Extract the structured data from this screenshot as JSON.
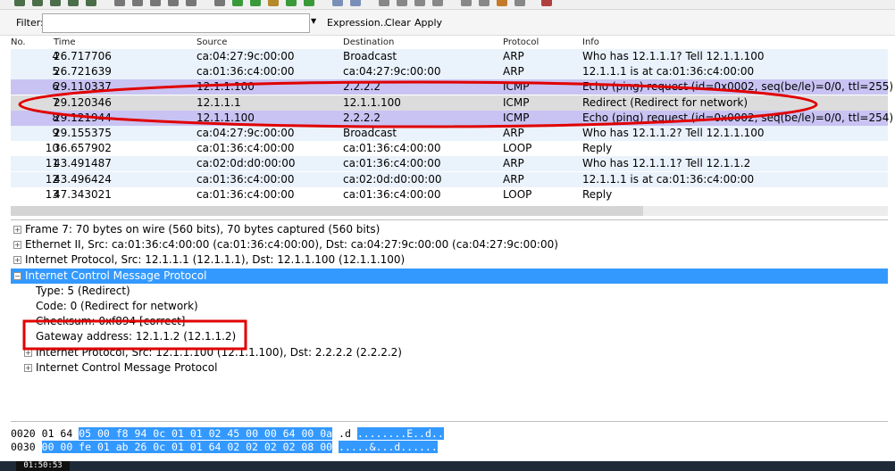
{
  "colors": {
    "arp_row": "#eaf2fb",
    "icmp_row": "#c8c3f3",
    "selected": "#dcdcdc",
    "broadcast_row": "#eaf2fb",
    "detail_selected": "#3399ff",
    "annotation": "#e00000"
  },
  "filter": {
    "label": "Filter:",
    "value": "",
    "expression_label": "Expression...",
    "clear_label": "Clear",
    "apply_label": "Apply"
  },
  "columns": [
    "No.",
    "Time",
    "Source",
    "Destination",
    "Protocol",
    "Info"
  ],
  "packets": [
    {
      "no": "4",
      "time": "26.717706",
      "src": "ca:04:27:9c:00:00",
      "dst": "Broadcast",
      "proto": "ARP",
      "info": "Who has 12.1.1.1?  Tell 12.1.1.100",
      "kind": "arp"
    },
    {
      "no": "5",
      "time": "26.721639",
      "src": "ca:01:36:c4:00:00",
      "dst": "ca:04:27:9c:00:00",
      "proto": "ARP",
      "info": "12.1.1.1 is at ca:01:36:c4:00:00",
      "kind": "arp"
    },
    {
      "no": "6",
      "time": "29.110337",
      "src": "12.1.1.100",
      "dst": "2.2.2.2",
      "proto": "ICMP",
      "info": "Echo (ping) request  (id=0x0002, seq(be/le)=0/0, ttl=255)",
      "kind": "icmp"
    },
    {
      "no": "7",
      "time": "29.120346",
      "src": "12.1.1.1",
      "dst": "12.1.1.100",
      "proto": "ICMP",
      "info": "Redirect             (Redirect for network)",
      "kind": "selected"
    },
    {
      "no": "8",
      "time": "29.121944",
      "src": "12.1.1.100",
      "dst": "2.2.2.2",
      "proto": "ICMP",
      "info": "Echo (ping) request  (id=0x0002, seq(be/le)=0/0, ttl=254)",
      "kind": "icmp"
    },
    {
      "no": "9",
      "time": "29.155375",
      "src": "ca:04:27:9c:00:00",
      "dst": "Broadcast",
      "proto": "ARP",
      "info": "Who has 12.1.1.2?  Tell 12.1.1.100",
      "kind": "arp"
    },
    {
      "no": "10",
      "time": "36.657902",
      "src": "ca:01:36:c4:00:00",
      "dst": "ca:01:36:c4:00:00",
      "proto": "LOOP",
      "info": "Reply",
      "kind": "plain"
    },
    {
      "no": "11",
      "time": "43.491487",
      "src": "ca:02:0d:d0:00:00",
      "dst": "ca:01:36:c4:00:00",
      "proto": "ARP",
      "info": "Who has 12.1.1.1?  Tell 12.1.1.2",
      "kind": "arp"
    },
    {
      "no": "12",
      "time": "43.496424",
      "src": "ca:01:36:c4:00:00",
      "dst": "ca:02:0d:d0:00:00",
      "proto": "ARP",
      "info": "12.1.1.1 is at ca:01:36:c4:00:00",
      "kind": "arp"
    },
    {
      "no": "13",
      "time": "47.343021",
      "src": "ca:01:36:c4:00:00",
      "dst": "ca:01:36:c4:00:00",
      "proto": "LOOP",
      "info": "Reply",
      "kind": "plain"
    }
  ],
  "details": [
    {
      "text": "Frame 7: 70 bytes on wire (560 bits), 70 bytes captured (560 bits)",
      "expander": "⊞",
      "level": 0,
      "selected": false
    },
    {
      "text": "Ethernet II, Src: ca:01:36:c4:00:00 (ca:01:36:c4:00:00), Dst: ca:04:27:9c:00:00 (ca:04:27:9c:00:00)",
      "expander": "⊞",
      "level": 0,
      "selected": false
    },
    {
      "text": "Internet Protocol, Src: 12.1.1.1 (12.1.1.1), Dst: 12.1.1.100 (12.1.1.100)",
      "expander": "⊞",
      "level": 0,
      "selected": false
    },
    {
      "text": "Internet Control Message Protocol",
      "expander": "⊟",
      "level": 0,
      "selected": true
    },
    {
      "text": "Type: 5 (Redirect)",
      "expander": "",
      "level": 1,
      "selected": false
    },
    {
      "text": "Code: 0 (Redirect for network)",
      "expander": "",
      "level": 1,
      "selected": false
    },
    {
      "text": "Checksum: 0xf894 [correct]",
      "expander": "",
      "level": 1,
      "selected": false
    },
    {
      "text": "Gateway address: 12.1.1.2 (12.1.1.2)",
      "expander": "",
      "level": 1,
      "selected": false
    },
    {
      "text": "Internet Protocol, Src: 12.1.1.100 (12.1.1.100), Dst: 2.2.2.2 (2.2.2.2)",
      "expander": "⊞",
      "level": 1,
      "selected": false
    },
    {
      "text": "Internet Control Message Protocol",
      "expander": "⊞",
      "level": 1,
      "selected": false
    }
  ],
  "hex": [
    {
      "offset": "0020",
      "plain": "01 64",
      "hl": "05 00 f8 94 0c 01  01 02 45 00 00 64 00 0a",
      "ascii_plain": ".d",
      "ascii_hl": "........E..d.."
    },
    {
      "offset": "0030",
      "plain": "",
      "hl": "00 00 fe 01 ab 26 0c 01  01 64 02 02 02 02 08 00",
      "ascii_plain": "",
      "ascii_hl": ".....&...d......"
    }
  ],
  "taskbar": {
    "clock": "01:50:53"
  }
}
